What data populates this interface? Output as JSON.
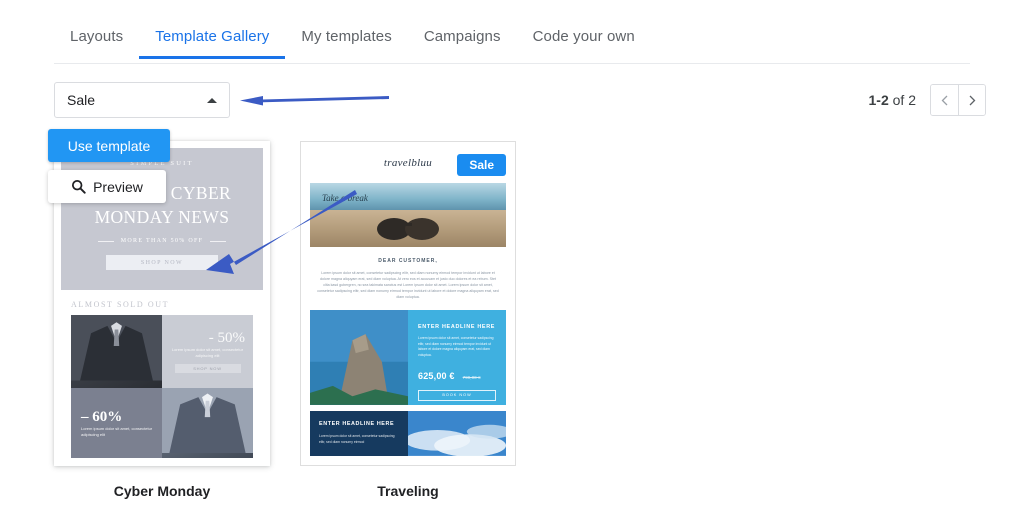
{
  "tabs": [
    {
      "label": "Layouts",
      "active": false
    },
    {
      "label": "Template Gallery",
      "active": true
    },
    {
      "label": "My templates",
      "active": false
    },
    {
      "label": "Campaigns",
      "active": false
    },
    {
      "label": "Code your own",
      "active": false
    }
  ],
  "toolbar": {
    "category_value": "Sale",
    "category_state": "expanded",
    "caret_icon": "chevron-up-icon"
  },
  "pagination": {
    "range": "1-2",
    "of_text": "of 2",
    "prev_icon": "chevron-left-icon",
    "next_icon": "chevron-right-icon"
  },
  "overlay": {
    "use_template_label": "Use template",
    "preview_label": "Preview",
    "preview_icon": "search-icon"
  },
  "colors": {
    "accent_blue": "#1a73e8",
    "button_blue": "#2196f3",
    "sale_badge_blue": "#1a8cf0",
    "annotation_arrow": "#3b5bc4",
    "tab_inactive": "#5f6368",
    "card_border": "#dedede"
  },
  "cards": [
    {
      "title": "Cyber Monday",
      "preview": {
        "kicker": "SIMPLE SUIT",
        "headline_line1": "SPECIAL CYBER",
        "headline_line2": "MONDAY NEWS",
        "subhead": "MORE THAN 50% OFF",
        "cta": "SHOP NOW",
        "section_label": "ALMOST SOLD OUT",
        "tiles": [
          {
            "discount": "- 50%",
            "body": "Lorem ipsum dolor sit amet, consectetur adipiscing elit",
            "button": "SHOP NOW"
          },
          {
            "discount": "– 60%",
            "body": "Lorem ipsum dolor sit amet, consectetur adipiscing elit"
          }
        ]
      }
    },
    {
      "title": "Traveling",
      "preview": {
        "logo": "travelbluu",
        "badge": "Sale",
        "hero_text": "Take a break",
        "greeting": "DEAR CUSTOMER,",
        "body": "Lorem ipsum dolor sit amet, consetetur sadipscing elitr, sed diam nonumy eirmod tempor invidunt ut labore et dolore magna aliquyam erat, sed diam voluptua. At vero eos et accusam et justo duo dolores et ea rebum. Stet clita kasd gubergren, no sea takimata sanctus est Lorem ipsum dolor sit amet. Lorem ipsum dolor sit amet, consetetur sadipscing elitr, sed diam nonumy eirmod tempor invidunt ut labore et dolore magna aliquyam erat, sed diam voluptua.",
        "section1_headline": "ENTER HEADLINE HERE",
        "section1_body": "Lorem ipsum dolor sit amet, consetetur sadipscing elitr, sed diam nonumy eirmod tempor invidunt ut labore et dolore magna aliquyam erat, sed diam voluptua.",
        "price": "625,00 €",
        "price_old": "799,00 €",
        "book_cta": "BOOK NOW",
        "section2_headline": "ENTER HEADLINE HERE",
        "section2_body": "Lorem ipsum dolor sit amet, consetetur sadipscing elitr, sed diam nonumy eirmod"
      }
    }
  ]
}
